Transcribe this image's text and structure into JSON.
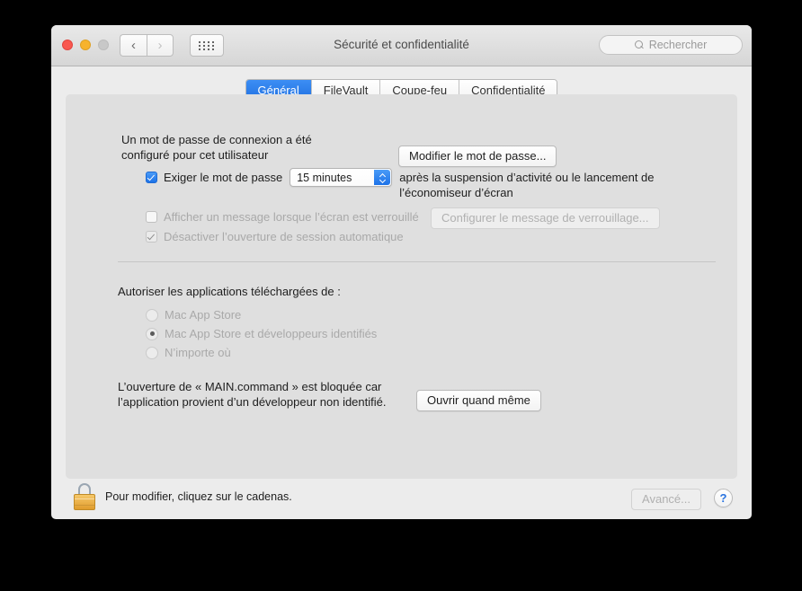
{
  "window": {
    "title": "Sécurité et confidentialité",
    "traffic_lights": [
      "close-button",
      "minimize-button",
      "zoom-button"
    ],
    "nav": {
      "back": "‹",
      "forward": "›",
      "show_all": "show-all-grid"
    },
    "search": {
      "placeholder": "Rechercher",
      "icon": "search-icon",
      "value": ""
    }
  },
  "tabs": [
    {
      "label": "Général",
      "active": true
    },
    {
      "label": "FileVault",
      "active": false
    },
    {
      "label": "Coupe-feu",
      "active": false
    },
    {
      "label": "Confidentialité",
      "active": false
    }
  ],
  "general": {
    "password_status": "Un mot de passe de connexion a été configuré pour cet utilisateur",
    "change_password_button": "Modifier le mot de passe...",
    "require_password": {
      "label": "Exiger le mot de passe",
      "checked": true,
      "delay_value": "15 minutes",
      "trailing_text": "après la suspension d’activité ou le lancement de l’économiseur d’écran"
    },
    "show_message": {
      "label": "Afficher un message lorsque l’écran est verrouillé",
      "checked": false,
      "enabled": false,
      "configure_button": "Configurer le message de verrouillage..."
    },
    "disable_auto_login": {
      "label": "Désactiver l’ouverture de session automatique",
      "checked": true,
      "enabled": false
    },
    "allow_apps_header": "Autoriser les applications téléchargées de :",
    "allow_apps_options": [
      {
        "label": "Mac App Store",
        "selected": false
      },
      {
        "label": "Mac App Store et développeurs identifiés",
        "selected": true
      },
      {
        "label": "N’importe où",
        "selected": false
      }
    ],
    "blocked_message": "L’ouverture de « MAIN.command » est bloquée car l’application provient d’un développeur non identifié.",
    "open_anyway_button": "Ouvrir quand même"
  },
  "bottom_bar": {
    "lock_icon": "lock-closed-icon",
    "lock_text": "Pour modifier, cliquez sur le cadenas.",
    "advanced_button": "Avancé...",
    "help_button": "?"
  },
  "colors": {
    "accent_blue": "#1d72e8",
    "window_bg": "#ececec",
    "panel_bg": "#dfdfdf",
    "lock_gold": "#e09c2c",
    "disabled_text": "#a9a9a9"
  }
}
